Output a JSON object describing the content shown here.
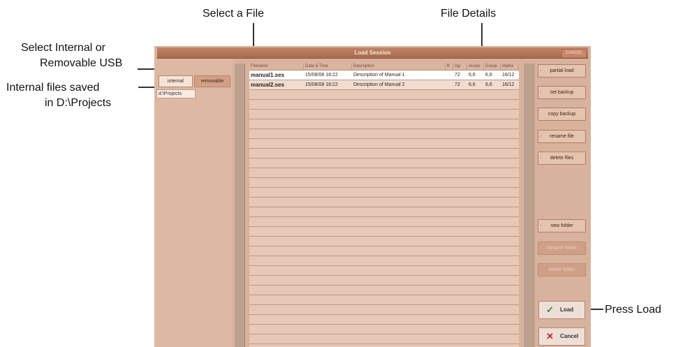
{
  "annotations": {
    "select_file": "Select a File",
    "file_details": "File Details",
    "select_internal_line1": "Select Internal or",
    "select_internal_line2": "Removable USB",
    "internal_saved_line1": "Internal files saved",
    "internal_saved_line2": "in D:\\Projects",
    "press_load": "Press Load"
  },
  "dialog": {
    "title": "Load Session",
    "cancel_top": "CANCEL"
  },
  "sidebar": {
    "tabs": [
      "internal",
      "removable"
    ],
    "folder": "d:\\Projects"
  },
  "table": {
    "headers": [
      "Filename",
      "Date & Time",
      "Description",
      "B",
      "Inp",
      "Auxes",
      "Group",
      "Matrix"
    ],
    "rows": [
      {
        "name": "manual1.ses",
        "date": "15/08/08 18:22",
        "desc": "Description of Manual 1",
        "inp": "72",
        "auxes": "6,6",
        "group": "6,6",
        "matrix": "16/12"
      },
      {
        "name": "manual2.ses",
        "date": "15/08/08 18:22",
        "desc": "Description of Manual 2",
        "inp": "72",
        "auxes": "6,6",
        "group": "6,6",
        "matrix": "16/12"
      }
    ]
  },
  "buttons": {
    "partial_load": "partial load",
    "set_backup": "set backup",
    "copy_backup": "copy backup",
    "rename_file": "rename file",
    "delete_files": "delete files",
    "new_folder": "new folder",
    "rename_folder": "rename folder",
    "delete_folder": "delete folder",
    "load": "Load",
    "cancel": "Cancel"
  },
  "colors": {
    "panel": "#d7b29d",
    "titlebar": "#b07153",
    "selected_row": "#ffffff",
    "load_icon": "#2e8b2e",
    "cancel_icon": "#cc2020"
  }
}
